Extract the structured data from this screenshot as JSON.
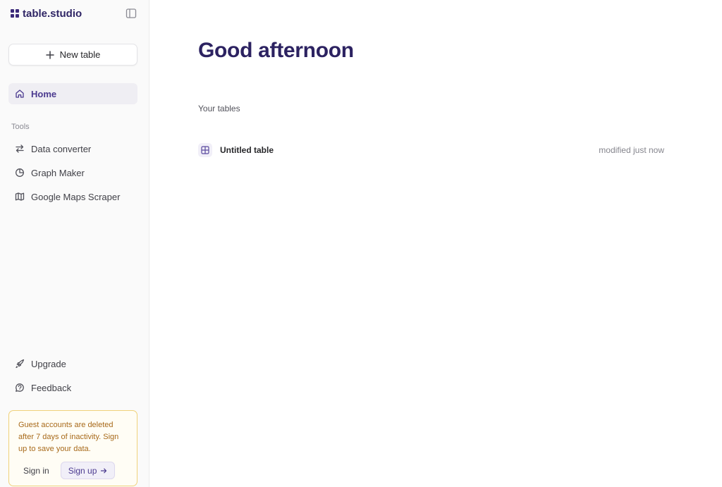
{
  "sidebar": {
    "brand": "table.studio",
    "new_table_label": "New table",
    "nav": {
      "home": "Home",
      "tools_label": "Tools",
      "data_converter": "Data converter",
      "graph_maker": "Graph Maker",
      "maps_scraper": "Google Maps Scraper",
      "upgrade": "Upgrade",
      "feedback": "Feedback"
    },
    "notice": {
      "message": "Guest accounts are deleted after 7 days of inactivity. Sign up to save your data.",
      "sign_in": "Sign in",
      "sign_up": "Sign up"
    }
  },
  "main": {
    "greeting": "Good afternoon",
    "tables_label": "Your tables",
    "tables": [
      {
        "name": "Untitled table",
        "modified": "modified just now"
      }
    ]
  },
  "colors": {
    "brand": "#2f2565",
    "accent": "#4b3a8f",
    "notice_border": "#f0d27a",
    "notice_text": "#a86a1a"
  },
  "icons": {
    "brand": "grid-icon",
    "collapse": "sidebar-panel-icon",
    "new_table": "plus-icon",
    "home": "home-icon",
    "data_converter": "arrows-exchange-icon",
    "graph_maker": "pie-chart-icon",
    "maps_scraper": "map-icon",
    "upgrade": "rocket-icon",
    "feedback": "message-icon",
    "sign_up": "arrow-right-icon",
    "table": "table-grid-icon"
  }
}
